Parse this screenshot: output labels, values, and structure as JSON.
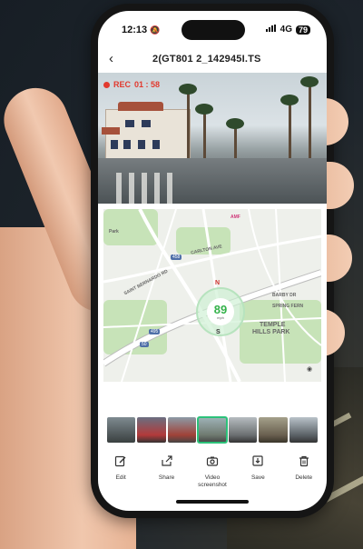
{
  "status_bar": {
    "time": "12:13",
    "network": "4G",
    "battery": "79"
  },
  "nav": {
    "back_icon": "chevron-left",
    "title": "2(GT801 2_142945I.TS"
  },
  "video": {
    "rec_label": "REC",
    "rec_time": "01 : 58"
  },
  "map": {
    "speed": "89",
    "speed_unit": "mph",
    "compass_n": "N",
    "compass_s": "S",
    "labels": {
      "park_top": "Park",
      "carlton": "CARLTON AVE",
      "bernardo": "SAINT BERNARDO RD",
      "barby": "BARBY DR",
      "spring": "SPRING FERN",
      "temple": "TEMPLE",
      "hills_park": "HILLS PARK",
      "amf": "AMF",
      "hwy458": "458",
      "hwy495": "495",
      "hwy50": "50"
    }
  },
  "toolbar": [
    {
      "icon": "edit-icon",
      "label": "Edit"
    },
    {
      "icon": "share-icon",
      "label": "Share"
    },
    {
      "icon": "camera-icon",
      "label": "Video screenshot"
    },
    {
      "icon": "save-icon",
      "label": "Save"
    },
    {
      "icon": "trash-icon",
      "label": "Delete"
    }
  ],
  "colors": {
    "rec": "#e23a2e",
    "speed": "#34b24a",
    "selected_thumb": "#2cc27a"
  }
}
